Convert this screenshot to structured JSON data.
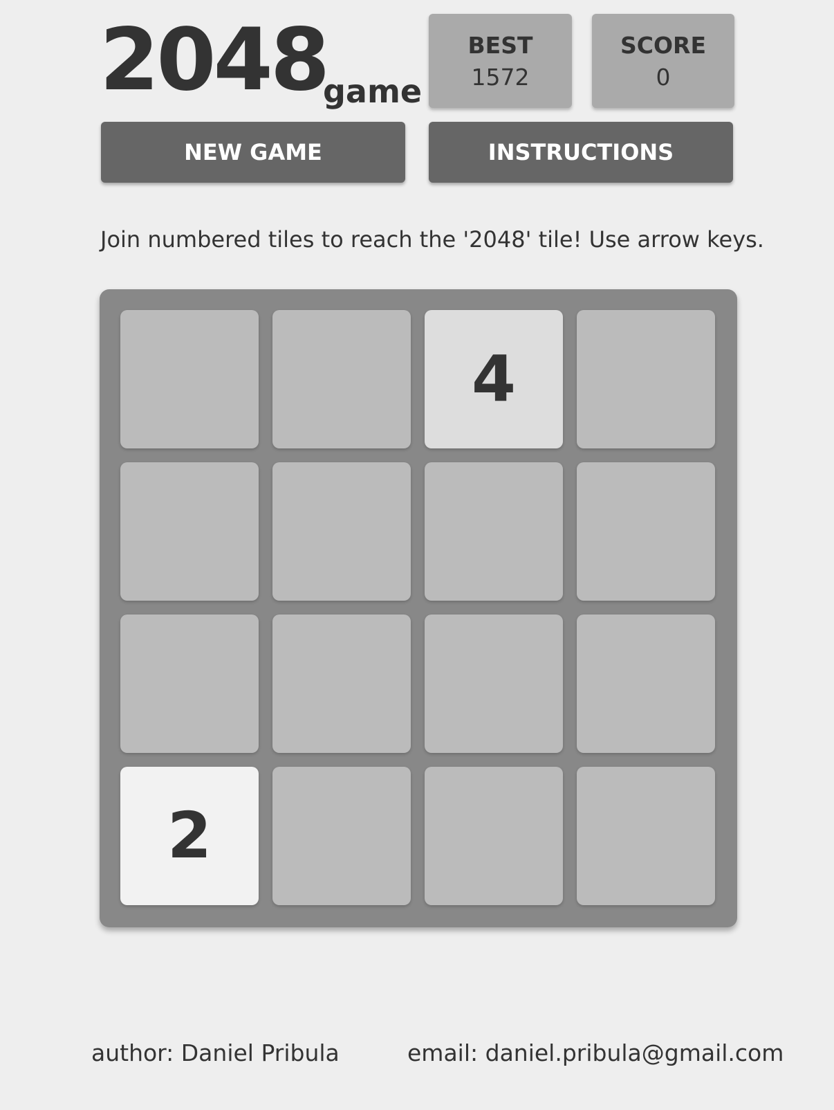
{
  "header": {
    "title": "2048",
    "subtitle": "game"
  },
  "scores": {
    "best_label": "BEST",
    "best_value": "1572",
    "score_label": "SCORE",
    "score_value": "0"
  },
  "buttons": {
    "new_game": "NEW GAME",
    "instructions": "INSTRUCTIONS"
  },
  "intro": "Join numbered tiles to reach the '2048' tile! Use arrow keys.",
  "board": {
    "rows": [
      [
        "",
        "",
        "4",
        ""
      ],
      [
        "",
        "",
        "",
        ""
      ],
      [
        "",
        "",
        "",
        ""
      ],
      [
        "2",
        "",
        "",
        ""
      ]
    ]
  },
  "footer": {
    "author": "author: Daniel Pribula",
    "email": "email: daniel.pribula@gmail.com"
  },
  "colors": {
    "background": "#eeeeee",
    "board": "#888888",
    "empty_cell": "#bbbbbb",
    "tile_2": "#f2f2f2",
    "tile_4": "#dddddd",
    "button": "#666666",
    "score_box": "#aaaaaa",
    "text": "#333333"
  }
}
